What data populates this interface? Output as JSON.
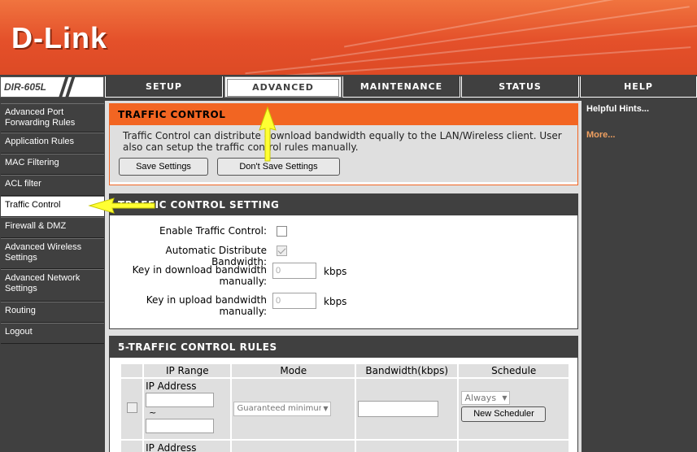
{
  "brand": {
    "logo": "D-Link",
    "model": "DIR-605L"
  },
  "nav": {
    "tabs": [
      {
        "label": "SETUP",
        "active": false
      },
      {
        "label": "ADVANCED",
        "active": true
      },
      {
        "label": "MAINTENANCE",
        "active": false
      },
      {
        "label": "STATUS",
        "active": false
      },
      {
        "label": "HELP",
        "active": false
      }
    ]
  },
  "sidebar": {
    "items": [
      {
        "label": "Advanced Port Forwarding Rules",
        "active": false
      },
      {
        "label": "Application Rules",
        "active": false
      },
      {
        "label": "MAC Filtering",
        "active": false
      },
      {
        "label": "ACL filter",
        "active": false
      },
      {
        "label": "Traffic Control",
        "active": true
      },
      {
        "label": "Firewall & DMZ",
        "active": false
      },
      {
        "label": "Advanced Wireless Settings",
        "active": false
      },
      {
        "label": "Advanced Network Settings",
        "active": false
      },
      {
        "label": "Routing",
        "active": false
      },
      {
        "label": "Logout",
        "active": false
      }
    ]
  },
  "traffic_control": {
    "title": "TRAFFIC CONTROL",
    "description": "Traffic Control can distribute download bandwidth equally to the LAN/Wireless client. User also can setup the traffic control rules manually.",
    "save_label": "Save Settings",
    "dont_save_label": "Don't Save Settings"
  },
  "setting": {
    "title": "TRAFFIC CONTROL SETTING",
    "enable_label": "Enable Traffic Control:",
    "enable_checked": false,
    "auto_label": "Automatic Distribute Bandwidth:",
    "auto_checked": true,
    "download_label": "Key in download bandwidth manually:",
    "download_value": "0",
    "upload_label": "Key in upload bandwidth manually:",
    "upload_value": "0",
    "unit": "kbps"
  },
  "rules": {
    "title": "5-TRAFFIC CONTROL RULES",
    "columns": [
      "",
      "IP Range",
      "Mode",
      "Bandwidth(kbps)",
      "Schedule"
    ],
    "ip_label": "IP Address",
    "tilde": "~",
    "mode_value": "Guaranteed minimum",
    "schedule_value": "Always",
    "new_scheduler_label": "New Scheduler"
  },
  "hints": {
    "title": "Helpful Hints...",
    "more": "More..."
  },
  "colors": {
    "accent": "#f26522",
    "dark": "#404040",
    "panel": "#dfdfdf",
    "annotation": "#ffff33"
  }
}
